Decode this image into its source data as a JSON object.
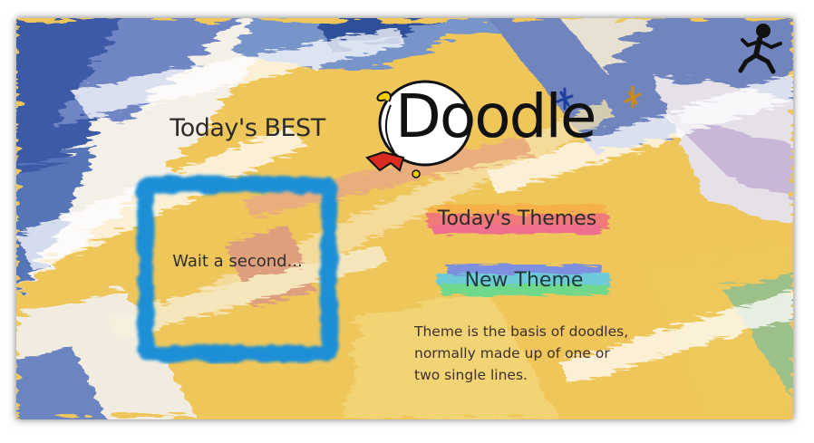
{
  "header": {
    "logo_text": "Doodle",
    "exit_icon": "running-man-icon"
  },
  "best": {
    "title": "Today's BEST",
    "placeholder": "Wait a second..."
  },
  "buttons": {
    "themes_label": "Today's Themes",
    "new_theme_label": "New Theme"
  },
  "description": {
    "lines": [
      "Theme is the basis of doodles,",
      "normally made up of one or",
      "two single lines."
    ]
  },
  "colors": {
    "frame_blue": "#1b8fd6",
    "themes_brush": "#f07a7a",
    "new_theme_brush": "#6fd88a",
    "paint_yellow": "#f0c44a"
  }
}
